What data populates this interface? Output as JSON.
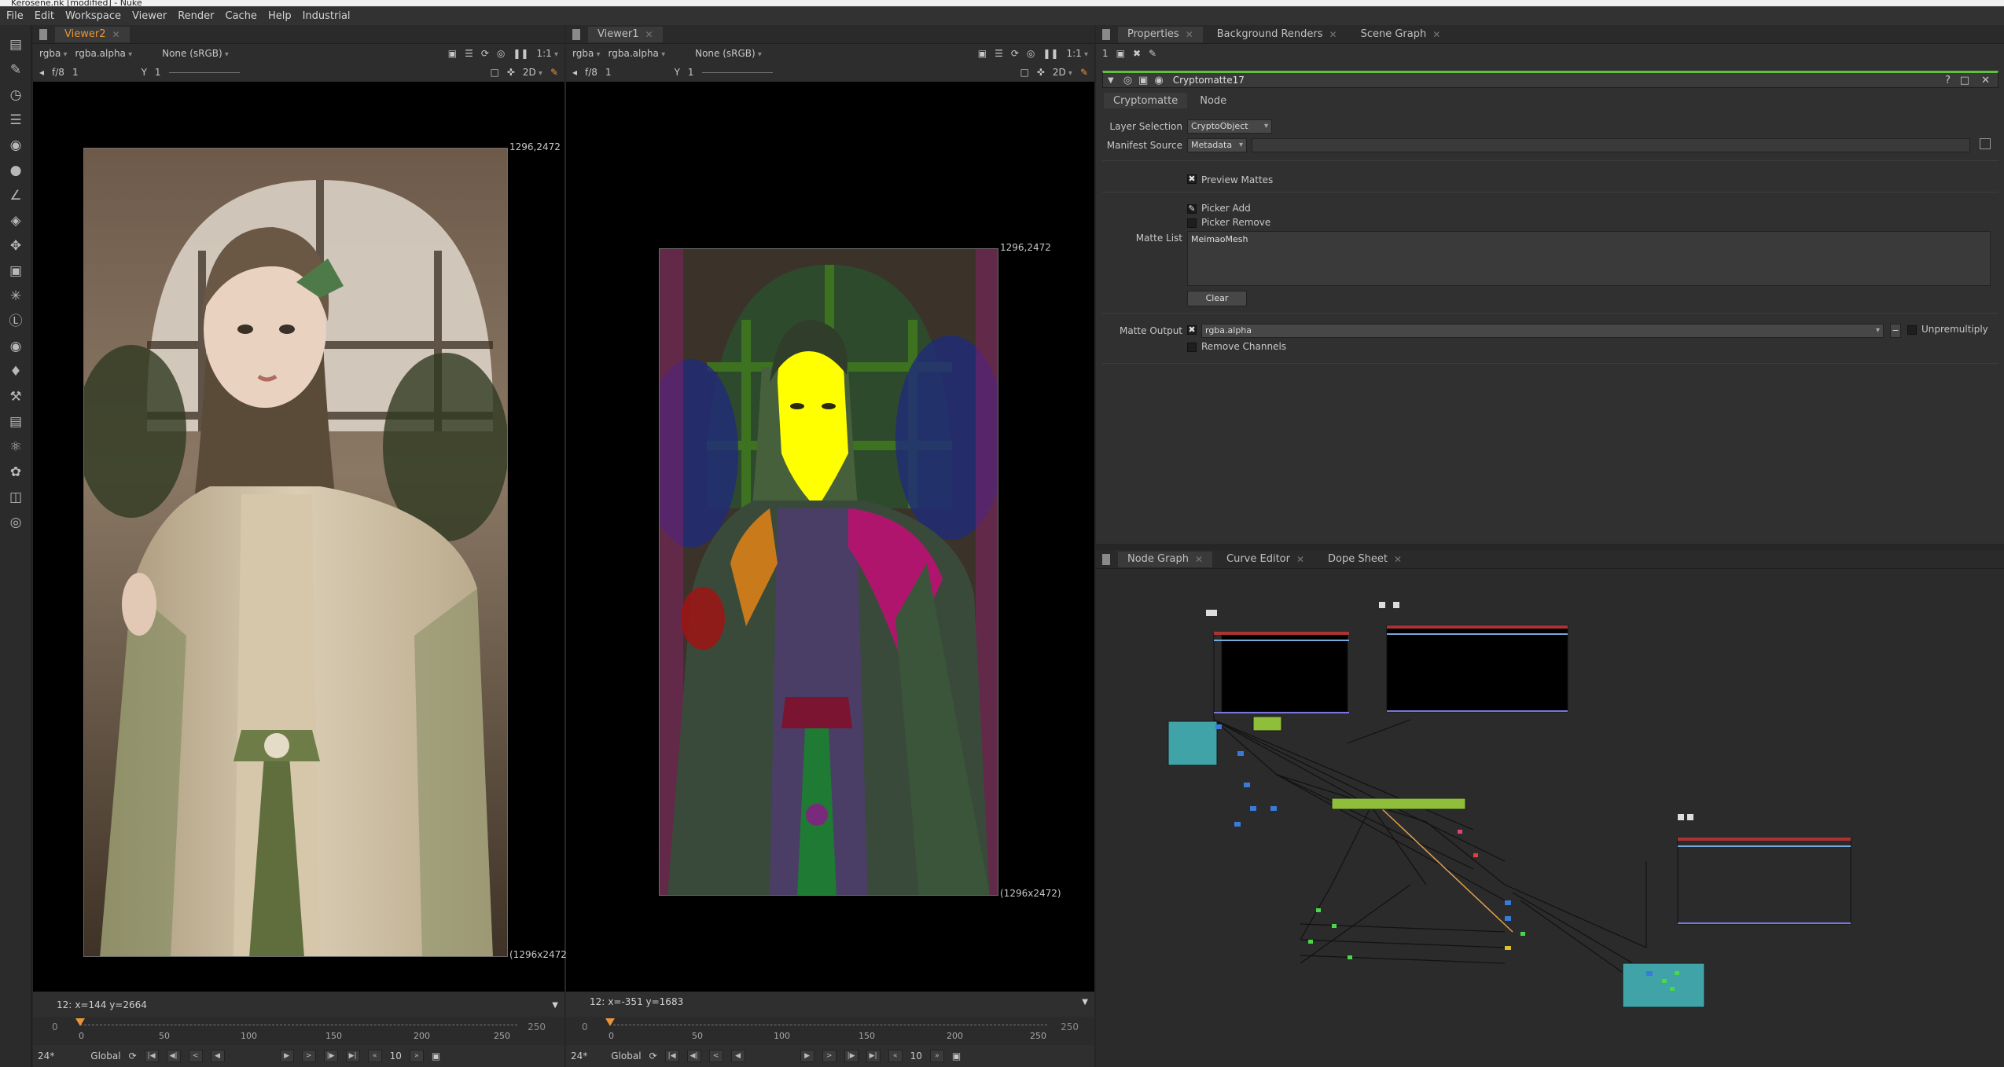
{
  "app": {
    "title": "Kerosene.nk [modified] - Nuke"
  },
  "menu": [
    "File",
    "Edit",
    "Workspace",
    "Viewer",
    "Render",
    "Cache",
    "Help",
    "Industrial"
  ],
  "toolbar_icons": [
    "viewer-icon",
    "paint-icon",
    "time-icon",
    "channel-icon",
    "color-icon",
    "filter-icon",
    "keyer-icon",
    "merge-icon",
    "transform-icon",
    "3d-icon",
    "particles-icon",
    "deep-icon",
    "views-icon",
    "metadata-icon",
    "toolsets-icon",
    "other-icon",
    "furnace-icon",
    "ocula-icon",
    "cara-icon",
    "plugin-icon"
  ],
  "viewer2": {
    "tab": "Viewer2",
    "channels": "rgba",
    "alpha": "rgba.alpha",
    "lut": "None (sRGB)",
    "zoom": "1:1",
    "fstop": "f/8",
    "exposure": "1",
    "gamma_label": "Y",
    "gamma": "1",
    "mode": "2D",
    "format_top": "1296,2472",
    "format_bottom": "(1296x2472)",
    "status_prefix": "12:",
    "status": "x=144 y=2664",
    "timeline": {
      "start": "0",
      "end": "250",
      "ticks": [
        "0",
        "50",
        "100",
        "150",
        "200",
        "250"
      ]
    },
    "fps": "24*",
    "scope": "Global",
    "step": "10"
  },
  "viewer1": {
    "tab": "Viewer1",
    "channels": "rgba",
    "alpha": "rgba.alpha",
    "lut": "None (sRGB)",
    "zoom": "1:1",
    "fstop": "f/8",
    "exposure": "1",
    "gamma_label": "Y",
    "gamma": "1",
    "mode": "2D",
    "format_top": "1296,2472",
    "format_bottom": "(1296x2472)",
    "status_prefix": "12:",
    "status": "x=-351 y=1683",
    "timeline": {
      "start": "0",
      "end": "250",
      "ticks": [
        "0",
        "50",
        "100",
        "150",
        "200",
        "250"
      ]
    },
    "fps": "24*",
    "scope": "Global",
    "step": "10"
  },
  "properties": {
    "tabs": [
      "Properties",
      "Background Renders",
      "Scene Graph"
    ],
    "count": "1",
    "node_name": "Cryptomatte17",
    "subtabs": [
      "Cryptomatte",
      "Node"
    ],
    "layer_selection_label": "Layer Selection",
    "layer_selection_value": "CryptoObject",
    "manifest_source_label": "Manifest Source",
    "manifest_source_value": "Metadata",
    "preview_mattes_label": "Preview Mattes",
    "picker_add_label": "Picker Add",
    "picker_remove_label": "Picker Remove",
    "matte_list_label": "Matte List",
    "matte_list_value": "MeimaoMesh",
    "clear_label": "Clear",
    "matte_output_label": "Matte Output",
    "matte_output_value": "rgba.alpha",
    "unpremultiply_label": "Unpremultiply",
    "remove_channels_label": "Remove Channels"
  },
  "graph": {
    "tabs": [
      "Node Graph",
      "Curve Editor",
      "Dope Sheet"
    ]
  },
  "colors": {
    "accent_orange": "#e8943a",
    "node_teal": "#3fa3a8",
    "node_green": "#8fbf3a",
    "matte_yellow": "#ffff00",
    "header_green": "#5cc23a"
  }
}
